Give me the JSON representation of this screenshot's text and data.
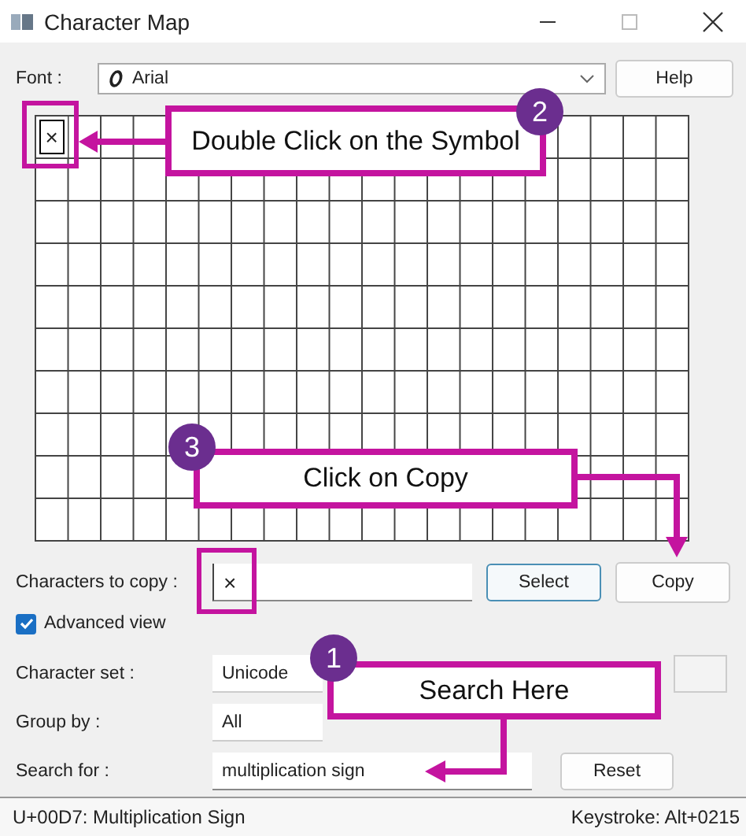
{
  "window": {
    "title": "Character Map"
  },
  "font": {
    "label": "Font :",
    "value": "Arial"
  },
  "help_button": "Help",
  "grid": {
    "cells": [
      {
        "symbol": "×",
        "selected": true
      }
    ]
  },
  "characters_to_copy": {
    "label": "Characters to copy :",
    "value": "×"
  },
  "select_button": {
    "label": "Select",
    "focused": true
  },
  "copy_button": {
    "label": "Copy",
    "focused": false
  },
  "advanced_view": {
    "label": "Advanced view",
    "checked": true
  },
  "character_set": {
    "label": "Character set :",
    "value": "Unicode"
  },
  "group_by": {
    "label": "Group by :",
    "value": "All"
  },
  "search": {
    "label": "Search for :",
    "value": "multiplication sign"
  },
  "reset_button": "Reset",
  "status_bar": {
    "left": "U+00D7: Multiplication Sign",
    "right": "Keystroke: Alt+0215"
  },
  "annotations": [
    {
      "number": "2",
      "text": "Double Click on the Symbol"
    },
    {
      "number": "3",
      "text": "Click on Copy"
    },
    {
      "number": "1",
      "text": "Search Here"
    }
  ]
}
